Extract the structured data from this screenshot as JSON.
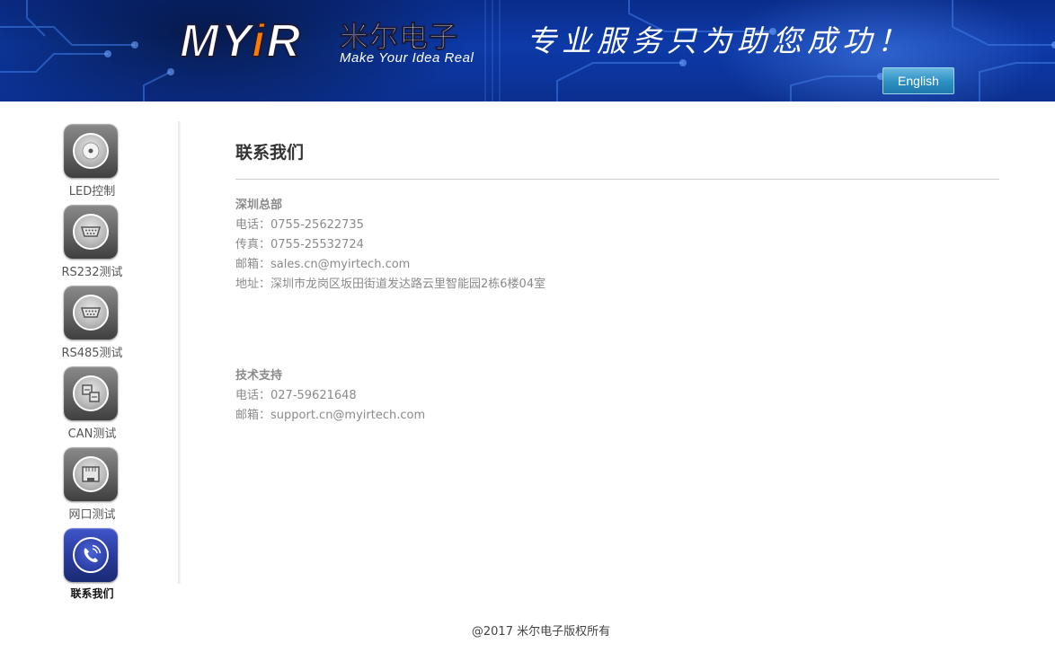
{
  "header": {
    "logo_text_pre": "MY",
    "logo_text_i": "i",
    "logo_text_post": "R",
    "logo_cn": "米尔电子",
    "logo_tagline": "Make Your Idea Real",
    "slogan": "专业服务只为助您成功！",
    "language_button": "English"
  },
  "sidebar": {
    "items": [
      {
        "label": "LED控制",
        "icon": "led-icon",
        "active": false
      },
      {
        "label": "RS232测试",
        "icon": "serial-port-icon",
        "active": false
      },
      {
        "label": "RS485测试",
        "icon": "serial-port-icon",
        "active": false
      },
      {
        "label": "CAN测试",
        "icon": "can-bus-icon",
        "active": false
      },
      {
        "label": "网口测试",
        "icon": "ethernet-port-icon",
        "active": false
      },
      {
        "label": "联系我们",
        "icon": "phone-icon",
        "active": true
      }
    ]
  },
  "main": {
    "title": "联系我们",
    "hq": {
      "heading": "深圳总部",
      "phone": "电话：0755-25622735",
      "fax": "传真：0755-25532724",
      "email": "邮箱：sales.cn@myirtech.com",
      "address": "地址：深圳市龙岗区坂田街道发达路云里智能园2栋6楼04室"
    },
    "support": {
      "heading": "技术支持",
      "phone": "电话：027-59621648",
      "email": "邮箱：support.cn@myirtech.com"
    }
  },
  "footer": {
    "copyright": "@2017 米尔电子版权所有"
  },
  "colors": {
    "header_blue": "#0d3aa8",
    "logo_dot_orange": "#ff7a00",
    "active_nav_blue": "#2a3c9e",
    "text_gray": "#8a8a8a"
  }
}
